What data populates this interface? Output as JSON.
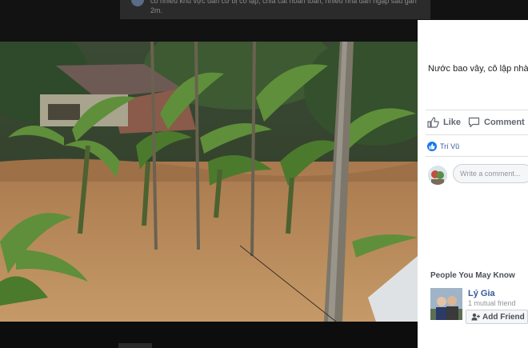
{
  "caption": {
    "text": "có nhiều khu vực dân cư bị cô lập, chia cắt hoàn toàn, nhiều nhà dân ngập sâu gần 2m."
  },
  "video": {
    "subject": "flooded village with banana trees and house roof"
  },
  "post": {
    "text": "Nước bao vây, cô lập nhà"
  },
  "actions": {
    "like_label": "Like",
    "comment_label": "Comment"
  },
  "reactions": {
    "name": "Trí Vũ"
  },
  "comment": {
    "placeholder": "Write a comment..."
  },
  "people_you_may_know": {
    "title": "People You May Know",
    "person": {
      "name": "Lý Gia",
      "mutual": "1 mutual friend",
      "add_label": "Add Friend"
    }
  },
  "colors": {
    "accent": "#1877f2",
    "link": "#365899",
    "flood_water": "#b88a5a"
  }
}
